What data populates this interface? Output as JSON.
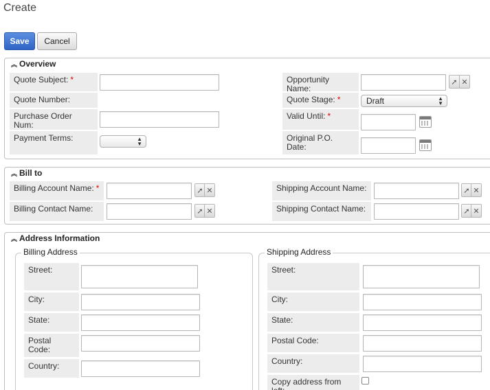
{
  "page": {
    "title": "Create"
  },
  "toolbar": {
    "save_label": "Save",
    "cancel_label": "Cancel"
  },
  "overview": {
    "header": "Overview",
    "quote_subject": "Quote Subject:",
    "quote_number": "Quote Number:",
    "purchase_order_num": "Purchase Order Num:",
    "payment_terms": "Payment Terms:",
    "payment_terms_value": "",
    "opportunity_name": "Opportunity Name:",
    "quote_stage": "Quote Stage:",
    "quote_stage_value": "Draft",
    "valid_until": "Valid Until:",
    "original_po_date": "Original P.O. Date:",
    "required_marker": "*"
  },
  "bill_to": {
    "header": "Bill to",
    "billing_account_name": "Billing Account Name:",
    "billing_contact_name": "Billing Contact Name:",
    "shipping_account_name": "Shipping Account Name:",
    "shipping_contact_name": "Shipping Contact Name:"
  },
  "address": {
    "header": "Address Information",
    "billing_legend": "Billing Address",
    "shipping_legend": "Shipping Address",
    "street": "Street:",
    "city": "City:",
    "state": "State:",
    "postal_code_billing": "Postal Code:",
    "postal_code_shipping": "Postal Code:",
    "country": "Country:",
    "copy_address": "Copy address from left:"
  },
  "icons": {
    "select": "arrow-select-icon",
    "clear": "clear-x-icon",
    "calendar": "calendar-icon",
    "collapse": "collapse-chevron-icon"
  }
}
